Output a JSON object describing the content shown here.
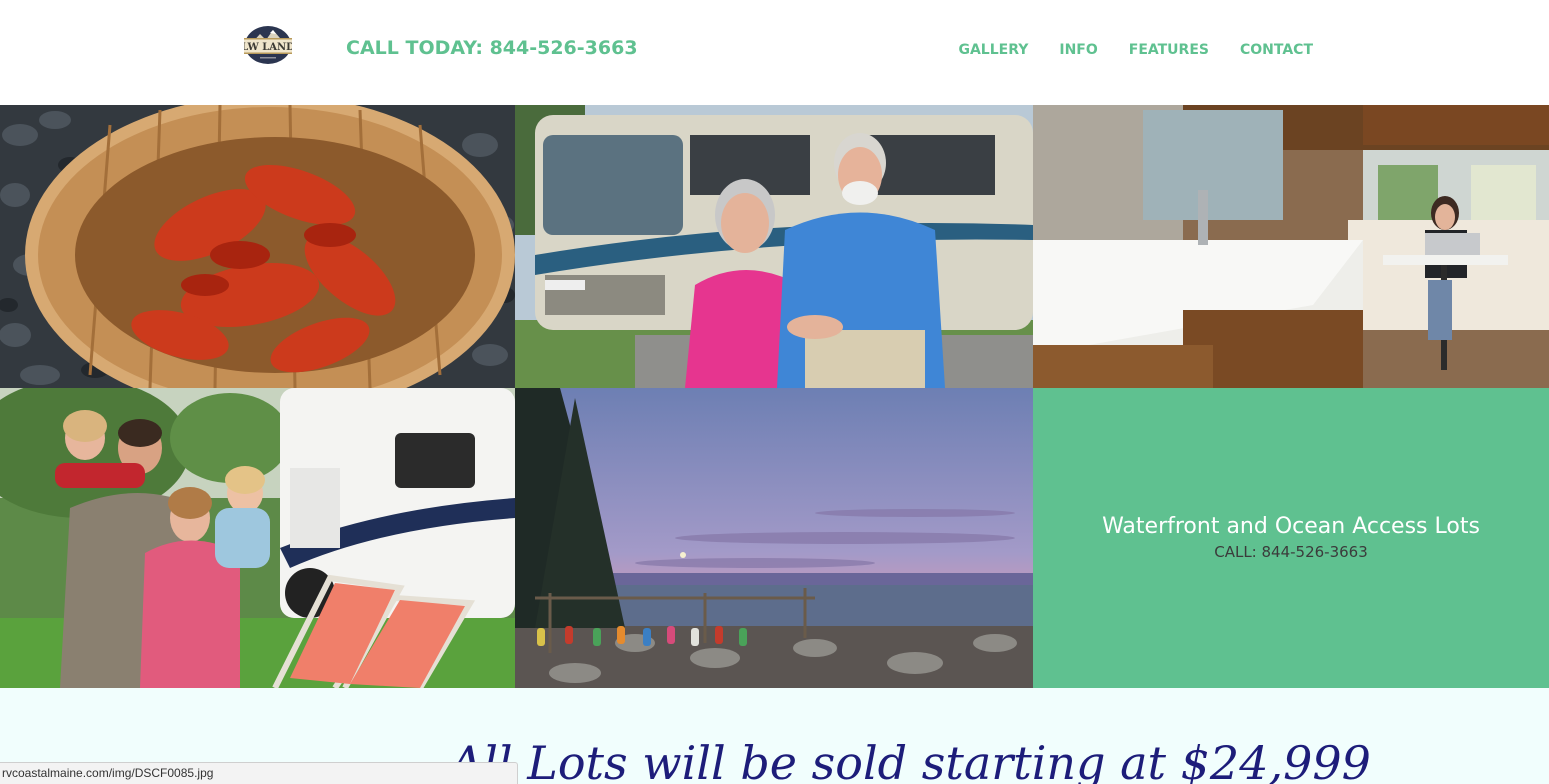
{
  "header": {
    "logo_text": "LW LAND",
    "callout": "CALL TODAY: 844-526-3663",
    "nav": [
      {
        "label": "GALLERY"
      },
      {
        "label": "INFO"
      },
      {
        "label": "FEATURES"
      },
      {
        "label": "CONTACT"
      }
    ]
  },
  "gallery": {
    "photos": [
      {
        "icon": "lobster-basket-photo"
      },
      {
        "icon": "couple-rv-photo"
      },
      {
        "icon": "rv-interior-photo"
      },
      {
        "icon": "family-camper-photo"
      },
      {
        "icon": "coastal-sunset-photo"
      }
    ],
    "promo": {
      "title": "Waterfront and Ocean Access Lots",
      "phone": "CALL: 844-526-3663"
    }
  },
  "lower": {
    "price_text": "All Lots will be sold starting at $24,999"
  },
  "status_bar": {
    "url": "rvcoastalmaine.com/img/DSCF0085.jpg"
  },
  "colors": {
    "accent": "#5fc190",
    "promo_phone": "#3b3b3b",
    "price_text": "#1d1d7a",
    "lower_bg": "#f1fefd"
  }
}
